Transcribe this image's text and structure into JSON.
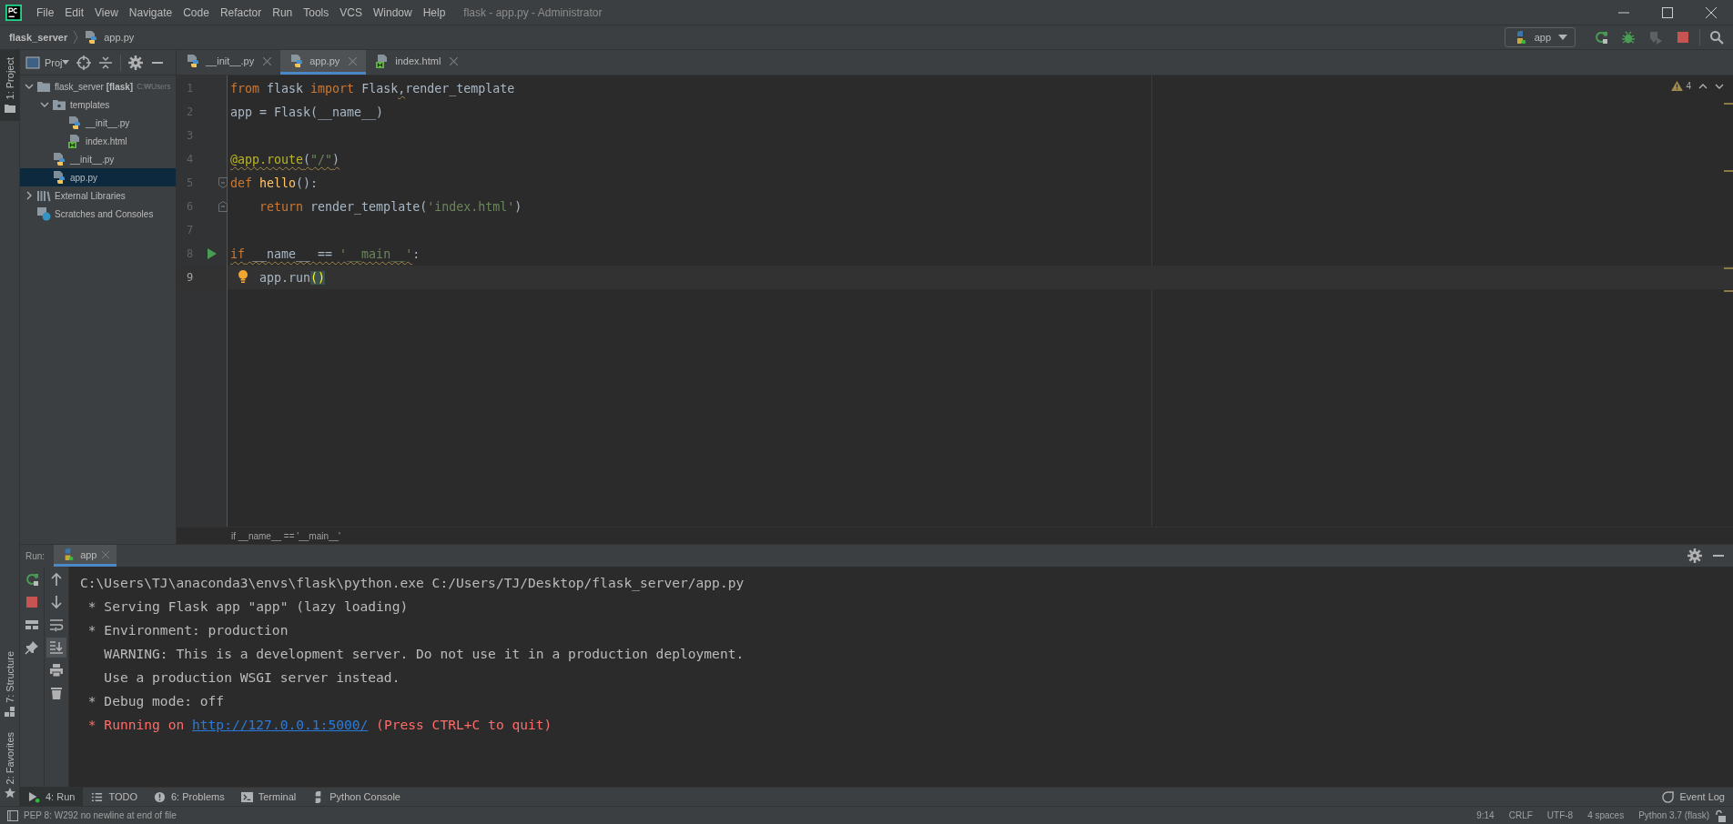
{
  "window": {
    "title": "flask - app.py - Administrator"
  },
  "menu": [
    "File",
    "Edit",
    "View",
    "Navigate",
    "Code",
    "Refactor",
    "Run",
    "Tools",
    "VCS",
    "Window",
    "Help"
  ],
  "breadcrumb": [
    {
      "label": "flask_server",
      "kind": "folder"
    },
    {
      "label": "app.py",
      "kind": "python"
    }
  ],
  "run_config": {
    "label": "app"
  },
  "left_tool_tabs": [
    {
      "label": "1: Project",
      "kind": "project",
      "selected": true
    },
    {
      "label": "7: Structure",
      "kind": "structure",
      "selected": false
    },
    {
      "label": "2: Favorites",
      "kind": "favorites",
      "selected": false
    }
  ],
  "project": {
    "title": "Proj",
    "tree": [
      {
        "label": "flask_server **[flask]**",
        "hint": "C:₩Users",
        "kind": "folder",
        "expanded": true,
        "selected": false,
        "children": [
          {
            "label": "templates",
            "kind": "template-folder",
            "expanded": true,
            "selected": false,
            "children": [
              {
                "label": "__init__.py",
                "kind": "python",
                "selected": false
              },
              {
                "label": "index.html",
                "kind": "html",
                "selected": false
              }
            ]
          },
          {
            "label": "__init__.py",
            "kind": "python",
            "selected": false
          },
          {
            "label": "app.py",
            "kind": "python",
            "selected": true
          }
        ]
      },
      {
        "label": "External Libraries",
        "kind": "libraries",
        "expanded": false,
        "selected": false
      },
      {
        "label": "Scratches and Consoles",
        "kind": "scratches",
        "selected": false
      }
    ]
  },
  "editor_tabs": [
    {
      "label": "__init__.py",
      "kind": "python",
      "selected": false
    },
    {
      "label": "app.py",
      "kind": "python",
      "selected": true
    },
    {
      "label": "index.html",
      "kind": "html",
      "selected": false
    }
  ],
  "inspection": {
    "warnings": "4"
  },
  "code_lines": [
    {
      "number": "1",
      "current": false,
      "tokens": [
        {
          "text": "from",
          "kind": "kw"
        },
        {
          "text": " flask ",
          "kind": "id"
        },
        {
          "text": "import",
          "kind": "kw"
        },
        {
          "text": " Flask",
          "kind": "id"
        },
        {
          "text": ",",
          "kind": "id",
          "underlined": true
        },
        {
          "text": "render_template",
          "kind": "id"
        }
      ]
    },
    {
      "number": "2",
      "current": false,
      "tokens": [
        {
          "text": "app = Flask(__name__)",
          "kind": "id"
        }
      ]
    },
    {
      "number": "3",
      "current": false
    },
    {
      "number": "4",
      "current": false,
      "tokens": [
        {
          "text": "@app.route",
          "kind": "dec",
          "underlined": true
        },
        {
          "text": "(",
          "kind": "id",
          "underlined": true
        },
        {
          "text": "\"/\"",
          "kind": "str",
          "underlined": true
        },
        {
          "text": ")",
          "kind": "id",
          "underlined": true
        }
      ]
    },
    {
      "number": "5",
      "current": false,
      "fold_start": true,
      "tokens": [
        {
          "text": "def ",
          "kind": "kw"
        },
        {
          "text": "hello",
          "kind": "fn"
        },
        {
          "text": "():",
          "kind": "id"
        }
      ]
    },
    {
      "number": "6",
      "current": false,
      "fold_end": true,
      "tokens": [
        {
          "text": "    return",
          "kind": "kw"
        },
        {
          "text": " render_template(",
          "kind": "id"
        },
        {
          "text": "'index.html'",
          "kind": "str"
        },
        {
          "text": ")",
          "kind": "id"
        }
      ]
    },
    {
      "number": "7",
      "current": false
    },
    {
      "number": "8",
      "current": false,
      "run": true,
      "tokens": [
        {
          "text": "if",
          "kind": "kw",
          "underlined": true
        },
        {
          "text": " __name__ == ",
          "kind": "id",
          "underlined": true
        },
        {
          "text": "'__main__'",
          "kind": "str",
          "underlined": true
        },
        {
          "text": ":",
          "kind": "id"
        }
      ]
    },
    {
      "number": "9",
      "current": true,
      "intention": true,
      "tokens": [
        {
          "text": "    app.run",
          "kind": "id"
        },
        {
          "text": "(",
          "kind": "match"
        },
        {
          "text": ")",
          "kind": "match"
        }
      ]
    }
  ],
  "editor_breadcrumb": "if __name__ == '__main__'",
  "run_panel": {
    "title": "Run:",
    "tab": "app",
    "console": [
      {
        "kind": "command",
        "parts": [
          {
            "text": "C:\\Users\\TJ\\anaconda3\\envs\\flask\\python.exe C:/Users/TJ/Desktop/flask_server/app.py",
            "kind": "text"
          }
        ]
      },
      {
        "kind": "output",
        "parts": [
          {
            "text": " * Serving Flask app \"app\" (lazy loading)",
            "kind": "text"
          }
        ]
      },
      {
        "kind": "output",
        "parts": [
          {
            "text": " * Environment: production",
            "kind": "text"
          }
        ]
      },
      {
        "kind": "output",
        "parts": [
          {
            "text": "   WARNING: This is a development server. Do not use it in a production deployment.",
            "kind": "text"
          }
        ]
      },
      {
        "kind": "output",
        "parts": [
          {
            "text": "   Use a production WSGI server instead.",
            "kind": "text"
          }
        ]
      },
      {
        "kind": "output",
        "parts": [
          {
            "text": " * Debug mode: off",
            "kind": "text"
          }
        ]
      },
      {
        "kind": "error",
        "parts": [
          {
            "text": " * Running on ",
            "kind": "text"
          },
          {
            "text": "http://127.0.0.1:5000/",
            "kind": "link"
          },
          {
            "text": " (Press CTRL+C to quit)",
            "kind": "text"
          }
        ]
      }
    ]
  },
  "bottom_tool_tabs": [
    {
      "label": "4: Run",
      "kind": "run",
      "selected": true
    },
    {
      "label": "TODO",
      "kind": "todo",
      "selected": false
    },
    {
      "label": "6: Problems",
      "kind": "problems",
      "selected": false
    },
    {
      "label": "Terminal",
      "kind": "terminal",
      "selected": false
    },
    {
      "label": "Python Console",
      "kind": "python-console",
      "selected": false
    }
  ],
  "event_log": "Event Log",
  "status_bar": {
    "message": "PEP 8: W292 no newline at end of file",
    "items": [
      "9:14",
      "CRLF",
      "UTF-8",
      "4 spaces",
      "Python 3.7 (flask)"
    ]
  }
}
